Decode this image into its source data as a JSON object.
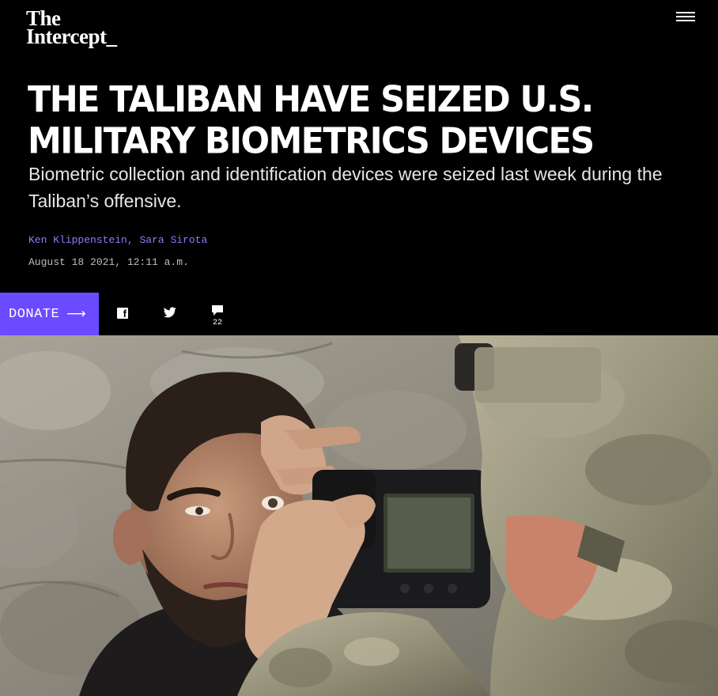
{
  "site": {
    "logo_line1": "The",
    "logo_line2": "Intercept_"
  },
  "article": {
    "headline": "The Taliban Have Seized U.S. Military Biometrics Devices",
    "subhead": "Biometric collection and identification devices were seized last week during the Taliban’s offensive.",
    "authors": [
      "Ken Klippenstein",
      "Sara Sirota"
    ],
    "author_separator": ",",
    "date": "August 18 2021, 12:11 a.m."
  },
  "actions": {
    "donate_label": "DONATE",
    "donate_arrow": "⟶",
    "comment_count": "22"
  },
  "icons": {
    "menu": "hamburger-menu-icon",
    "facebook": "facebook-icon",
    "twitter": "twitter-icon",
    "comments": "comment-bubble-icon"
  },
  "colors": {
    "background": "#000000",
    "accent": "#6b4bff",
    "byline": "#8c7cff"
  }
}
